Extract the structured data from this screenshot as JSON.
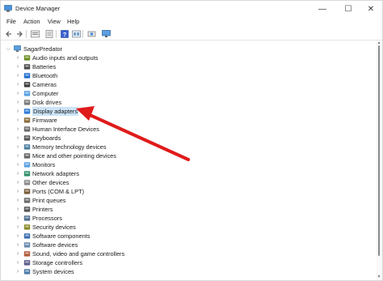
{
  "window": {
    "title": "Device Manager",
    "controls": {
      "minimize": "—",
      "maximize": "☐",
      "close": "✕"
    }
  },
  "menu": [
    "File",
    "Action",
    "View",
    "Help"
  ],
  "toolbar": [
    "back-icon",
    "forward-icon",
    "properties-icon",
    "update-icon",
    "help-icon",
    "view-icon",
    "scan-icon",
    "monitor-icon"
  ],
  "tree": {
    "root": "SagarPredator",
    "items": [
      {
        "label": "Audio inputs and outputs",
        "icon": "audio-icon"
      },
      {
        "label": "Batteries",
        "icon": "battery-icon"
      },
      {
        "label": "Bluetooth",
        "icon": "bluetooth-icon"
      },
      {
        "label": "Cameras",
        "icon": "camera-icon"
      },
      {
        "label": "Computer",
        "icon": "computer-icon"
      },
      {
        "label": "Disk drives",
        "icon": "disk-icon"
      },
      {
        "label": "Display adapters",
        "icon": "display-adapter-icon",
        "selected": true
      },
      {
        "label": "Firmware",
        "icon": "firmware-icon"
      },
      {
        "label": "Human Interface Devices",
        "icon": "hid-icon"
      },
      {
        "label": "Keyboards",
        "icon": "keyboard-icon"
      },
      {
        "label": "Memory technology devices",
        "icon": "memory-icon"
      },
      {
        "label": "Mice and other pointing devices",
        "icon": "mouse-icon"
      },
      {
        "label": "Monitors",
        "icon": "monitor-icon"
      },
      {
        "label": "Network adapters",
        "icon": "network-icon"
      },
      {
        "label": "Other devices",
        "icon": "other-devices-icon"
      },
      {
        "label": "Ports (COM & LPT)",
        "icon": "port-icon"
      },
      {
        "label": "Print queues",
        "icon": "print-queue-icon"
      },
      {
        "label": "Printers",
        "icon": "printer-icon"
      },
      {
        "label": "Processors",
        "icon": "processor-icon"
      },
      {
        "label": "Security devices",
        "icon": "security-icon"
      },
      {
        "label": "Software components",
        "icon": "software-component-icon"
      },
      {
        "label": "Software devices",
        "icon": "software-device-icon"
      },
      {
        "label": "Sound, video and game controllers",
        "icon": "sound-icon"
      },
      {
        "label": "Storage controllers",
        "icon": "storage-icon"
      },
      {
        "label": "System devices",
        "icon": "system-icon"
      }
    ]
  },
  "colors": {
    "selection": "#cce4f7",
    "annotation_arrow": "#e01b1b"
  }
}
